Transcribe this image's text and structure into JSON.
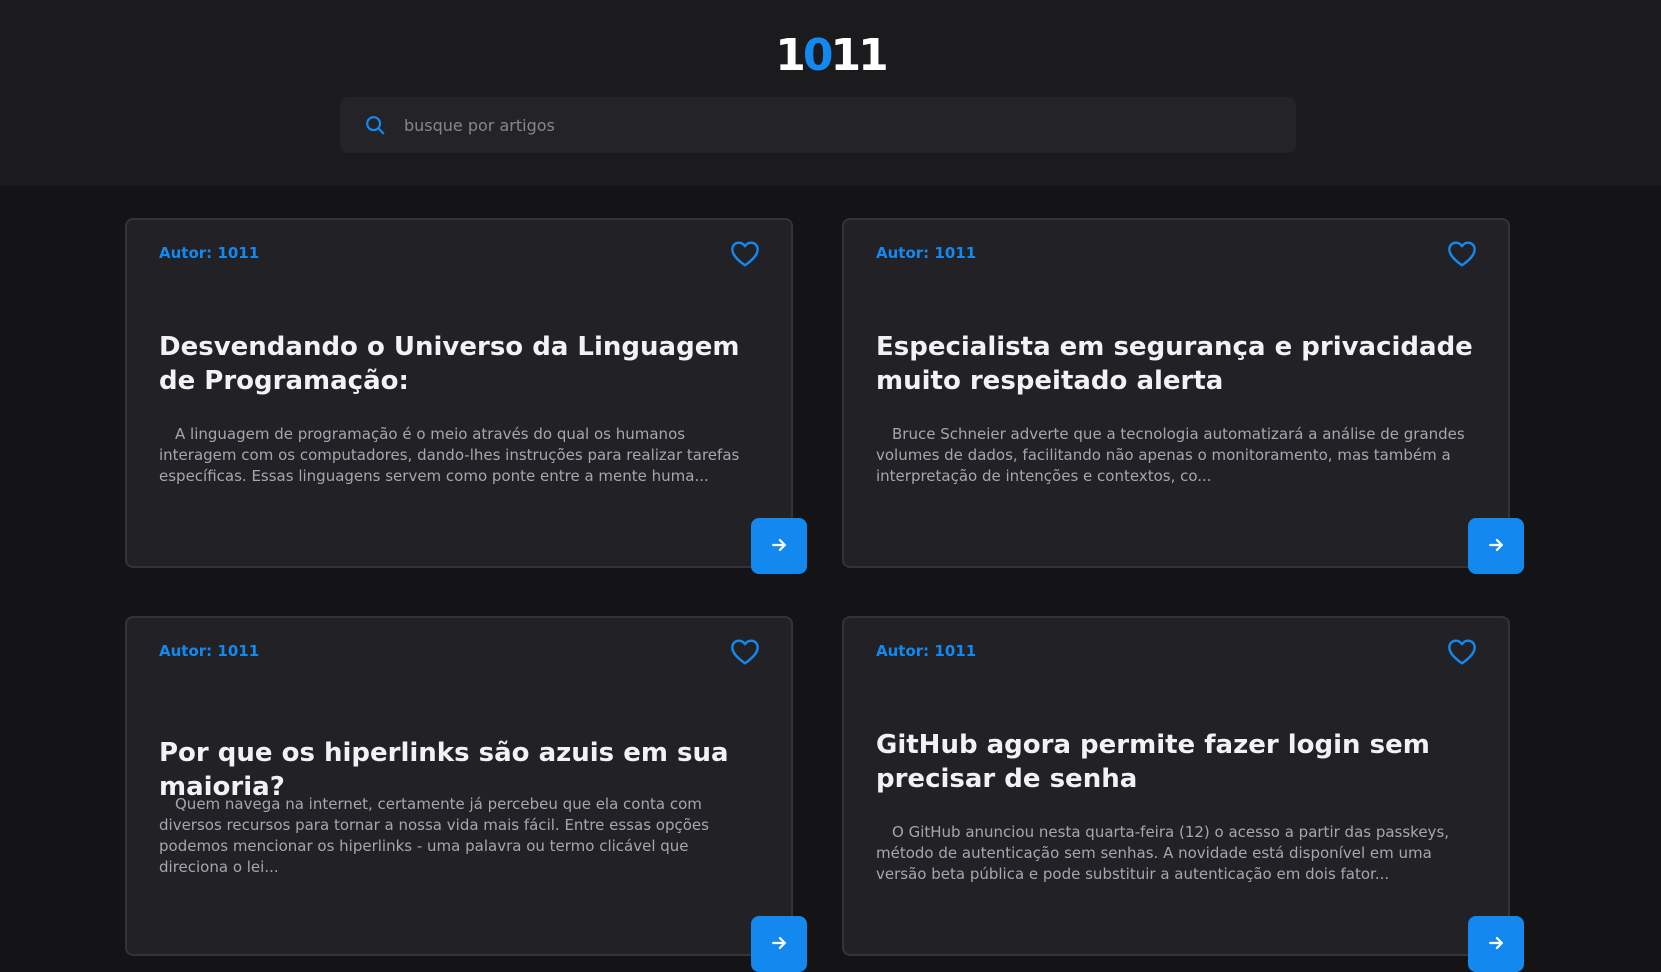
{
  "header": {
    "logo": {
      "part1": "1",
      "accent": "0",
      "part2": "11"
    },
    "search": {
      "placeholder": "busque por artigos",
      "value": ""
    }
  },
  "colors": {
    "accent": "#1389f0",
    "background": "#141417",
    "card": "#212126"
  },
  "icons": {
    "search": "search-icon",
    "favorite": "heart-icon",
    "open": "arrow-right-icon"
  },
  "articles": [
    {
      "author": "Autor: 1011",
      "title": "Desvendando o Universo da Linguagem de Programação:",
      "excerpt": "A linguagem de programação é o meio através do qual os humanos interagem com os computadores, dando-lhes instruções para realizar tarefas específicas. Essas linguagens servem como ponte entre a mente huma..."
    },
    {
      "author": "Autor: 1011",
      "title": "Especialista em segurança e privacidade muito respeitado alerta",
      "excerpt": "Bruce Schneier adverte que a tecnologia automatizará a análise de grandes volumes de dados, facilitando não apenas o monitoramento, mas também a interpretação de intenções e contextos, co..."
    },
    {
      "author": "Autor: 1011",
      "title": "Por que os hiperlinks são azuis em sua maioria?",
      "excerpt": "Quem navega na internet, certamente já percebeu que ela conta com diversos recursos para tornar a nossa vida mais fácil. Entre essas opções podemos mencionar os hiperlinks - uma palavra ou termo clicável que direciona o lei..."
    },
    {
      "author": "Autor: 1011",
      "title": "GitHub agora permite fazer login sem precisar de senha",
      "excerpt": "O GitHub anunciou nesta quarta-feira (12) o acesso a partir das passkeys, método de autenticação sem senhas. A novidade está disponível em uma versão beta pública e pode substituir a autenticação em dois fator..."
    }
  ]
}
